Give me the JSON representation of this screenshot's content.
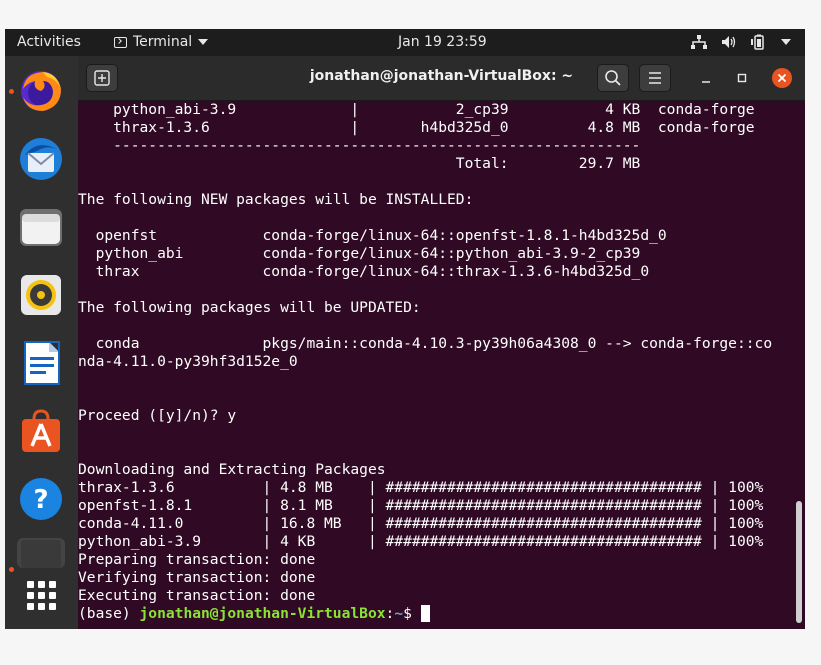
{
  "topbar": {
    "activities": "Activities",
    "app_name": "Terminal",
    "clock": "Jan 19  23:59",
    "icons": [
      "network-icon",
      "volume-icon",
      "battery-icon",
      "system-menu-caret-icon"
    ]
  },
  "dock": {
    "items": [
      {
        "name": "firefox",
        "icon": "firefox-icon",
        "running": true
      },
      {
        "name": "thunderbird",
        "icon": "thunderbird-icon",
        "running": false
      },
      {
        "name": "files",
        "icon": "files-icon",
        "running": false
      },
      {
        "name": "rhythmbox",
        "icon": "rhythmbox-icon",
        "running": false
      },
      {
        "name": "libreoffice-writer",
        "icon": "writer-icon",
        "running": false
      },
      {
        "name": "ubuntu-software",
        "icon": "software-center-icon",
        "running": false
      },
      {
        "name": "help",
        "icon": "help-icon",
        "running": false
      },
      {
        "name": "terminal",
        "icon": "terminal-icon",
        "running": true
      },
      {
        "name": "show-applications",
        "icon": "app-grid-icon",
        "running": false
      }
    ]
  },
  "window": {
    "title": "jonathan@jonathan-VirtualBox: ~"
  },
  "terminal": {
    "lines": [
      "    python_abi-3.9             |           2_cp39           4 KB  conda-forge",
      "    thrax-1.3.6                |       h4bd325d_0         4.8 MB  conda-forge",
      "    ------------------------------------------------------------",
      "                                           Total:        29.7 MB",
      "",
      "The following NEW packages will be INSTALLED:",
      "",
      "  openfst            conda-forge/linux-64::openfst-1.8.1-h4bd325d_0",
      "  python_abi         conda-forge/linux-64::python_abi-3.9-2_cp39",
      "  thrax              conda-forge/linux-64::thrax-1.3.6-h4bd325d_0",
      "",
      "The following packages will be UPDATED:",
      "",
      "  conda              pkgs/main::conda-4.10.3-py39h06a4308_0 --> conda-forge::co",
      "nda-4.11.0-py39hf3d152e_0",
      "",
      "",
      "Proceed ([y]/n)? y",
      "",
      "",
      "Downloading and Extracting Packages",
      "thrax-1.3.6          | 4.8 MB    | #################################### | 100%",
      "openfst-1.8.1        | 8.1 MB    | #################################### | 100%",
      "conda-4.11.0         | 16.8 MB   | #################################### | 100%",
      "python_abi-3.9       | 4 KB      | #################################### | 100%",
      "Preparing transaction: done",
      "Verifying transaction: done",
      "Executing transaction: done"
    ],
    "prompt": {
      "env": "(base) ",
      "user_host": "jonathan@jonathan-VirtualBox",
      "sep": ":",
      "path": "~",
      "symbol": "$ "
    }
  },
  "colors": {
    "terminal_bg": "#300a24",
    "prompt_user": "#8ae234",
    "prompt_path": "#729fcf",
    "close_button": "#e95420"
  }
}
